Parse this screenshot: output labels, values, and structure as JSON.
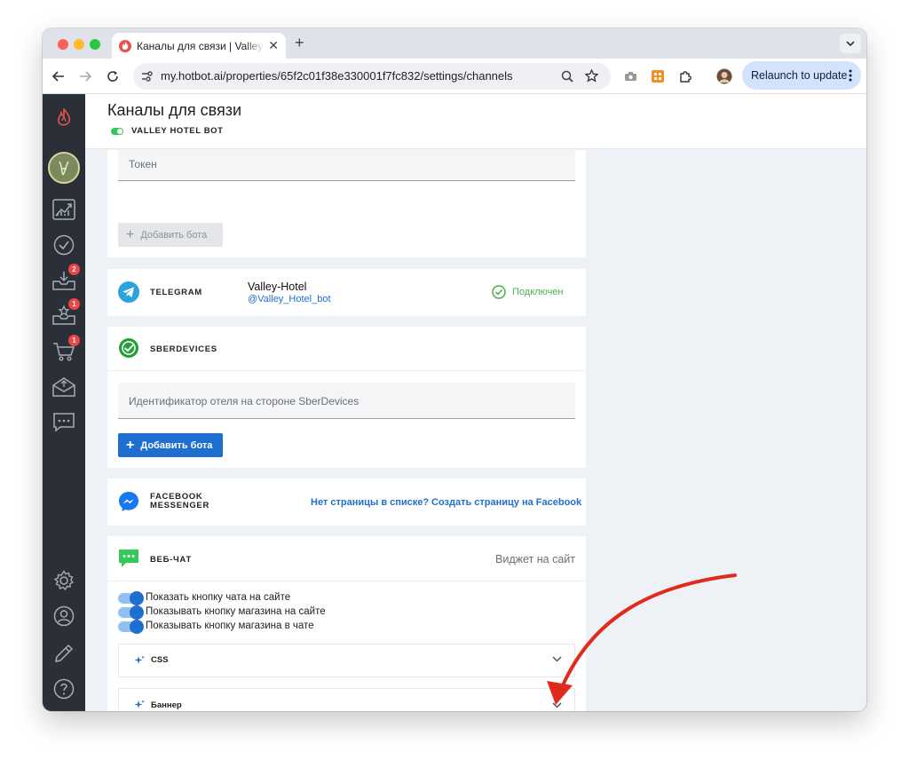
{
  "browser": {
    "tab_title": "Каналы для связи | Valley Hotel Bot",
    "close_glyph": "✕",
    "newtab_glyph": "+",
    "url": "my.hotbot.ai/properties/65f2c01f38e330001f7fc832/settings/channels",
    "relaunch_label": "Relaunch to update"
  },
  "sidebar": {
    "badges": {
      "inbox": "2",
      "reviews": "1",
      "shop": "1"
    }
  },
  "header": {
    "title": "Каналы для связи",
    "bot_name": "VALLEY HOTEL BOT"
  },
  "channels": {
    "top": {
      "token_placeholder": "Токен",
      "add_bot_label": "Добавить бота"
    },
    "telegram": {
      "label": "TELEGRAM",
      "bot_name": "Valley-Hotel",
      "bot_handle": "@Valley_Hotel_bot",
      "status": "Подключен",
      "status_color": "#4caf50"
    },
    "sber": {
      "label": "SBERDEVICES",
      "field_placeholder": "Идентификатор отеля на стороне SberDevices",
      "add_bot_label": "Добавить бота"
    },
    "facebook": {
      "label_line1": "FACEBOOK",
      "label_line2": "MESSENGER",
      "link_missing": "Нет страницы в списке?",
      "link_create": "Создать страницу на Facebook"
    },
    "webchat": {
      "label": "ВЕБ-ЧАТ",
      "widget_link": "Виджет на сайт",
      "toggles": [
        "Показать кнопку чата на сайте",
        "Показывать кнопку магазина на сайте",
        "Показывать кнопку магазина в чате"
      ],
      "accordions": [
        "CSS",
        "Баннер"
      ]
    }
  },
  "colors": {
    "accent": "#1f6fd0",
    "sidebar_bg": "#2b2f37",
    "annotation_arrow": "#e02a1b"
  }
}
